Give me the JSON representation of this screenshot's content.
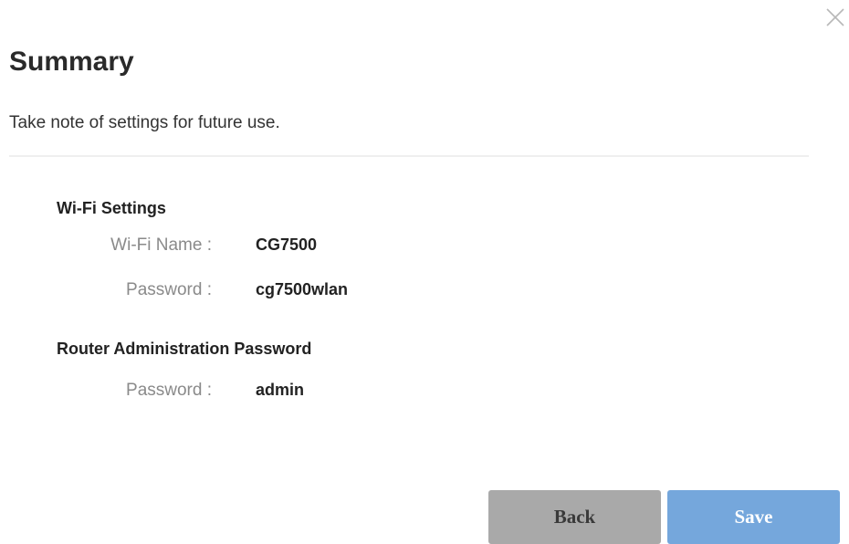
{
  "dialog": {
    "title": "Summary",
    "subtitle": "Take note of settings for future use.",
    "close_icon": "close-icon"
  },
  "wifi": {
    "heading": "Wi-Fi Settings",
    "name_label": "Wi-Fi Name :",
    "name_value": "CG7500",
    "password_label": "Password :",
    "password_value": "cg7500wlan"
  },
  "admin": {
    "heading": "Router Administration Password",
    "password_label": "Password :",
    "password_value": "admin"
  },
  "buttons": {
    "back_label": "Back",
    "save_label": "Save"
  },
  "colors": {
    "back_button": "#a9a9a9",
    "save_button": "#75a7dc",
    "label_gray": "#8a8a8a"
  }
}
